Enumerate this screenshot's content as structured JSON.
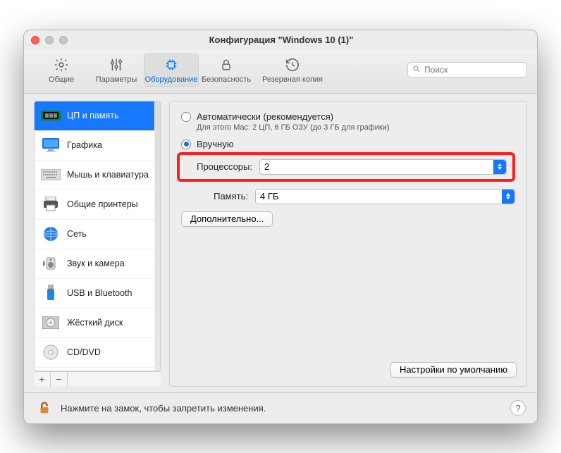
{
  "window_title": "Конфигурация \"Windows 10 (1)\"",
  "search_placeholder": "Поиск",
  "toolbar": [
    {
      "key": "general",
      "label": "Общие"
    },
    {
      "key": "options",
      "label": "Параметры"
    },
    {
      "key": "hardware",
      "label": "Оборудование"
    },
    {
      "key": "security",
      "label": "Безопасность"
    },
    {
      "key": "backup",
      "label": "Резервная копия"
    }
  ],
  "sidebar": [
    {
      "key": "cpu",
      "label": "ЦП и память"
    },
    {
      "key": "graphics",
      "label": "Графика"
    },
    {
      "key": "mouse",
      "label": "Мышь и клавиатура"
    },
    {
      "key": "printers",
      "label": "Общие принтеры"
    },
    {
      "key": "network",
      "label": "Сеть"
    },
    {
      "key": "sound",
      "label": "Звук и камера"
    },
    {
      "key": "usb",
      "label": "USB и Bluetooth"
    },
    {
      "key": "hdd",
      "label": "Жёсткий диск"
    },
    {
      "key": "cddvd",
      "label": "CD/DVD"
    }
  ],
  "mode": {
    "auto_label": "Автоматически (рекомендуется)",
    "auto_sub": "Для этого Mac: 2 ЦП, 6 ГБ ОЗУ (до 3 ГБ для графики)",
    "manual_label": "Вручную"
  },
  "fields": {
    "processors_label": "Процессоры:",
    "processors_value": "2",
    "memory_label": "Память:",
    "memory_value": "4 ГБ"
  },
  "advanced_button": "Дополнительно...",
  "defaults_button": "Настройки по умолчанию",
  "lock_text": "Нажмите на замок, чтобы запретить изменения.",
  "help": "?"
}
